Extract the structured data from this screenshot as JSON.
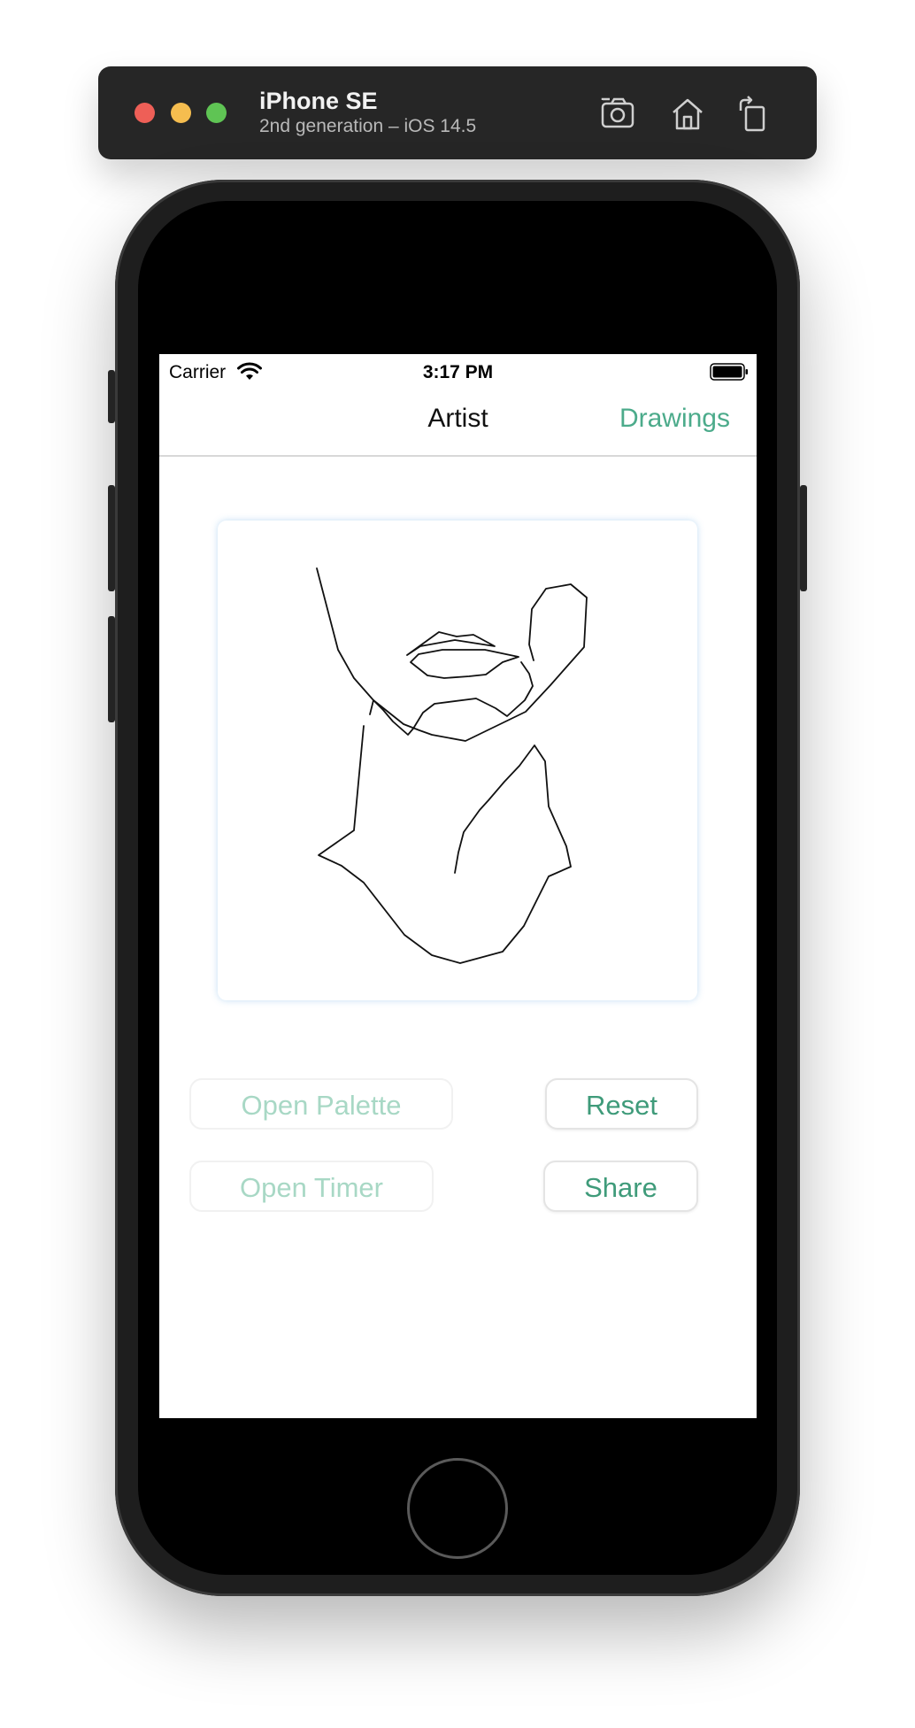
{
  "simulator": {
    "device_name": "iPhone SE",
    "device_subtitle": "2nd generation – iOS 14.5",
    "toolbar_icons": [
      "screenshot-icon",
      "home-icon",
      "rotate-icon"
    ]
  },
  "status_bar": {
    "carrier": "Carrier",
    "time": "3:17 PM"
  },
  "nav": {
    "title": "Artist",
    "right_button": "Drawings"
  },
  "buttons": {
    "open_palette": "Open Palette",
    "reset": "Reset",
    "open_timer": "Open Timer",
    "share": "Share"
  },
  "colors": {
    "accent": "#4cab8b",
    "accent_disabled": "#a8d8c5",
    "stroke": "#111111"
  }
}
